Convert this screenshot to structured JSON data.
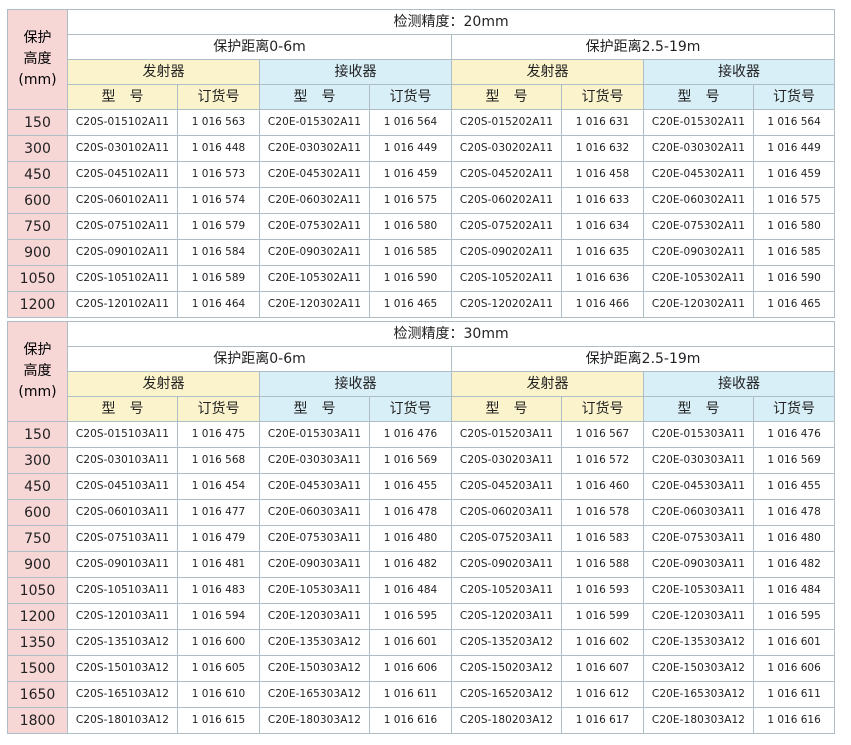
{
  "labels": {
    "height_header": "保护\n高度\n(mm)",
    "emitter": "发射器",
    "receiver": "接收器",
    "model": "型　号",
    "order_no": "订货号",
    "range_1": "保护距离0-6m",
    "range_2": "保护距离2.5-19m"
  },
  "sections": [
    {
      "precision": "检测精度：20mm",
      "rows": [
        {
          "h": "150",
          "e1m": "C20S-015102A11",
          "e1o": "1 016 563",
          "r1m": "C20E-015302A11",
          "r1o": "1 016 564",
          "e2m": "C20S-015202A11",
          "e2o": "1 016 631",
          "r2m": "C20E-015302A11",
          "r2o": "1 016 564"
        },
        {
          "h": "300",
          "e1m": "C20S-030102A11",
          "e1o": "1 016 448",
          "r1m": "C20E-030302A11",
          "r1o": "1 016 449",
          "e2m": "C20S-030202A11",
          "e2o": "1 016 632",
          "r2m": "C20E-030302A11",
          "r2o": "1 016 449"
        },
        {
          "h": "450",
          "e1m": "C20S-045102A11",
          "e1o": "1 016 573",
          "r1m": "C20E-045302A11",
          "r1o": "1 016 459",
          "e2m": "C20S-045202A11",
          "e2o": "1 016 458",
          "r2m": "C20E-045302A11",
          "r2o": "1 016 459"
        },
        {
          "h": "600",
          "e1m": "C20S-060102A11",
          "e1o": "1 016 574",
          "r1m": "C20E-060302A11",
          "r1o": "1 016 575",
          "e2m": "C20S-060202A11",
          "e2o": "1 016 633",
          "r2m": "C20E-060302A11",
          "r2o": "1 016 575"
        },
        {
          "h": "750",
          "e1m": "C20S-075102A11",
          "e1o": "1 016 579",
          "r1m": "C20E-075302A11",
          "r1o": "1 016 580",
          "e2m": "C20S-075202A11",
          "e2o": "1 016 634",
          "r2m": "C20E-075302A11",
          "r2o": "1 016 580"
        },
        {
          "h": "900",
          "e1m": "C20S-090102A11",
          "e1o": "1 016 584",
          "r1m": "C20E-090302A11",
          "r1o": "1 016 585",
          "e2m": "C20S-090202A11",
          "e2o": "1 016 635",
          "r2m": "C20E-090302A11",
          "r2o": "1 016 585"
        },
        {
          "h": "1050",
          "e1m": "C20S-105102A11",
          "e1o": "1 016 589",
          "r1m": "C20E-105302A11",
          "r1o": "1 016 590",
          "e2m": "C20S-105202A11",
          "e2o": "1 016 636",
          "r2m": "C20E-105302A11",
          "r2o": "1 016 590"
        },
        {
          "h": "1200",
          "e1m": "C20S-120102A11",
          "e1o": "1 016 464",
          "r1m": "C20E-120302A11",
          "r1o": "1 016 465",
          "e2m": "C20S-120202A11",
          "e2o": "1 016 466",
          "r2m": "C20E-120302A11",
          "r2o": "1 016 465"
        }
      ]
    },
    {
      "precision": "检测精度：30mm",
      "rows": [
        {
          "h": "150",
          "e1m": "C20S-015103A11",
          "e1o": "1 016 475",
          "r1m": "C20E-015303A11",
          "r1o": "1 016 476",
          "e2m": "C20S-015203A11",
          "e2o": "1 016 567",
          "r2m": "C20E-015303A11",
          "r2o": "1 016 476"
        },
        {
          "h": "300",
          "e1m": "C20S-030103A11",
          "e1o": "1 016 568",
          "r1m": "C20E-030303A11",
          "r1o": "1 016 569",
          "e2m": "C20S-030203A11",
          "e2o": "1 016 572",
          "r2m": "C20E-030303A11",
          "r2o": "1 016 569"
        },
        {
          "h": "450",
          "e1m": "C20S-045103A11",
          "e1o": "1 016 454",
          "r1m": "C20E-045303A11",
          "r1o": "1 016 455",
          "e2m": "C20S-045203A11",
          "e2o": "1 016 460",
          "r2m": "C20E-045303A11",
          "r2o": "1 016 455"
        },
        {
          "h": "600",
          "e1m": "C20S-060103A11",
          "e1o": "1 016 477",
          "r1m": "C20E-060303A11",
          "r1o": "1 016 478",
          "e2m": "C20S-060203A11",
          "e2o": "1 016 578",
          "r2m": "C20E-060303A11",
          "r2o": "1 016 478"
        },
        {
          "h": "750",
          "e1m": "C20S-075103A11",
          "e1o": "1 016 479",
          "r1m": "C20E-075303A11",
          "r1o": "1 016 480",
          "e2m": "C20S-075203A11",
          "e2o": "1 016 583",
          "r2m": "C20E-075303A11",
          "r2o": "1 016 480"
        },
        {
          "h": "900",
          "e1m": "C20S-090103A11",
          "e1o": "1 016 481",
          "r1m": "C20E-090303A11",
          "r1o": "1 016 482",
          "e2m": "C20S-090203A11",
          "e2o": "1 016 588",
          "r2m": "C20E-090303A11",
          "r2o": "1 016 482"
        },
        {
          "h": "1050",
          "e1m": "C20S-105103A11",
          "e1o": "1 016 483",
          "r1m": "C20E-105303A11",
          "r1o": "1 016 484",
          "e2m": "C20S-105203A11",
          "e2o": "1 016 593",
          "r2m": "C20E-105303A11",
          "r2o": "1 016 484"
        },
        {
          "h": "1200",
          "e1m": "C20S-120103A11",
          "e1o": "1 016 594",
          "r1m": "C20E-120303A11",
          "r1o": "1 016 595",
          "e2m": "C20S-120203A11",
          "e2o": "1 016 599",
          "r2m": "C20E-120303A11",
          "r2o": "1 016 595"
        },
        {
          "h": "1350",
          "e1m": "C20S-135103A12",
          "e1o": "1 016 600",
          "r1m": "C20E-135303A12",
          "r1o": "1 016 601",
          "e2m": "C20S-135203A12",
          "e2o": "1 016 602",
          "r2m": "C20E-135303A12",
          "r2o": "1 016 601"
        },
        {
          "h": "1500",
          "e1m": "C20S-150103A12",
          "e1o": "1 016 605",
          "r1m": "C20E-150303A12",
          "r1o": "1 016 606",
          "e2m": "C20S-150203A12",
          "e2o": "1 016 607",
          "r2m": "C20E-150303A12",
          "r2o": "1 016 606"
        },
        {
          "h": "1650",
          "e1m": "C20S-165103A12",
          "e1o": "1 016 610",
          "r1m": "C20E-165303A12",
          "r1o": "1 016 611",
          "e2m": "C20S-165203A12",
          "e2o": "1 016 612",
          "r2m": "C20E-165303A12",
          "r2o": "1 016 611"
        },
        {
          "h": "1800",
          "e1m": "C20S-180103A12",
          "e1o": "1 016 615",
          "r1m": "C20E-180303A12",
          "r1o": "1 016 616",
          "e2m": "C20S-180203A12",
          "e2o": "1 016 617",
          "r2m": "C20E-180303A12",
          "r2o": "1 016 616"
        }
      ]
    }
  ]
}
